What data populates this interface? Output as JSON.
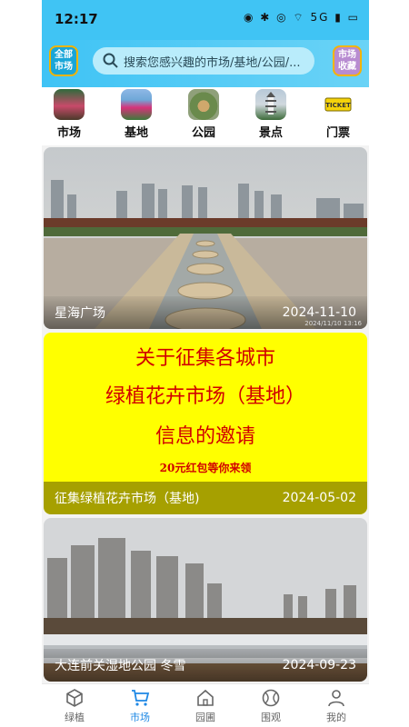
{
  "status_bar": {
    "time": "12:17",
    "icons": "◉ ✱ ◎ ⌔ 5G ▮ ▭"
  },
  "header": {
    "all_markets_label": "全部\n市场",
    "search_placeholder": "搜索您感兴趣的市场/基地/公园/...",
    "favorites_label": "市场\n收藏"
  },
  "categories": [
    {
      "label": "市场",
      "icon": "market-photo"
    },
    {
      "label": "基地",
      "icon": "flowerbed-photo"
    },
    {
      "label": "公园",
      "icon": "park-photo"
    },
    {
      "label": "景点",
      "icon": "pagoda-photo"
    },
    {
      "label": "门票",
      "icon": "ticket-icon"
    }
  ],
  "cards": [
    {
      "title": "星海广场",
      "date": "2024-11-10",
      "image_stamp": "2024/11/10 13:16"
    },
    {
      "title": "征集绿植花卉市场（基地)",
      "date": "2024-05-02",
      "poster": {
        "line1": "关于征集各城市",
        "line2": "绿植花卉市场（基地）",
        "line3": "信息的邀请",
        "line4": "20元红包等你来领"
      }
    },
    {
      "title": "大连前关湿地公园 冬雪",
      "date": "2024-09-23"
    }
  ],
  "tabs": [
    {
      "label": "绿植",
      "active": false
    },
    {
      "label": "市场",
      "active": true
    },
    {
      "label": "园圃",
      "active": false
    },
    {
      "label": "围观",
      "active": false
    },
    {
      "label": "我的",
      "active": false
    }
  ],
  "colors": {
    "accent": "#40c4f4",
    "active_tab": "#1e88e5",
    "poster_bg": "#ffff00",
    "poster_text": "#d10000"
  }
}
